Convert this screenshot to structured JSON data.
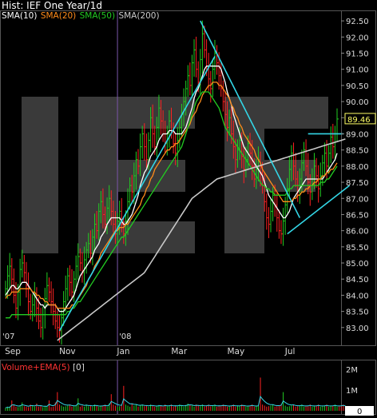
{
  "header": {
    "title": "Hist: IEF One Year/1d"
  },
  "legend": [
    {
      "label": "SMA(10)",
      "color": "#ffffff"
    },
    {
      "label": "SMA(20)",
      "color": "#ff8c1a"
    },
    {
      "label": "SMA(50)",
      "color": "#22cc22"
    },
    {
      "label": "SMA(200)",
      "color": "#cccccc"
    }
  ],
  "volume_legend": {
    "label": "Volume+EMA(5)",
    "label_color": "#ff3333",
    "bracket": "[0]"
  },
  "colors": {
    "background": "#000000",
    "up_bar": "#22cc22",
    "down_bar": "#ff2222",
    "trendline": "#33d6e6",
    "watermark": "#3a3a3a",
    "last_price_box": "#ffff66"
  },
  "watermark_text": "IEF",
  "chart_data": [
    {
      "type": "line",
      "title": "Hist: IEF One Year/1d",
      "ylim": [
        82.5,
        92.8
      ],
      "yticks": [
        83.0,
        83.5,
        84.0,
        84.5,
        85.0,
        85.5,
        86.0,
        86.5,
        87.0,
        87.5,
        88.0,
        88.5,
        89.0,
        89.5,
        90.0,
        90.5,
        91.0,
        91.5,
        92.0,
        92.5
      ],
      "ytick_labels": [
        "83.00",
        "83.50",
        "84.00",
        "84.50",
        "85.00",
        "85.50",
        "86.00",
        "86.50",
        "87.00",
        "87.50",
        "88.00",
        "88.50",
        "89.00",
        "89.50",
        "90.00",
        "90.50",
        "91.00",
        "91.50",
        "92.00",
        "92.50"
      ],
      "x_labels": [
        "Sep",
        "Nov",
        "Jan",
        "Mar",
        "May",
        "Jul"
      ],
      "year_markers": [
        "'07",
        "'08"
      ],
      "last_price": 89.46,
      "last_price_label": "89.46",
      "grid": false,
      "legend_placement": "top-left",
      "closes": [
        84.2,
        84.6,
        84.9,
        84.5,
        84.0,
        83.6,
        84.1,
        84.8,
        85.0,
        84.7,
        84.3,
        83.8,
        83.5,
        83.7,
        84.0,
        83.6,
        83.2,
        83.0,
        83.4,
        83.9,
        84.3,
        84.1,
        83.8,
        83.5,
        83.2,
        83.0,
        82.9,
        83.3,
        83.8,
        84.2,
        84.6,
        84.4,
        84.1,
        84.5,
        84.9,
        85.2,
        85.0,
        84.7,
        85.1,
        85.4,
        85.6,
        85.3,
        85.8,
        86.2,
        86.0,
        86.6,
        86.9,
        86.5,
        86.2,
        86.7,
        87.0,
        86.6,
        86.2,
        85.9,
        86.3,
        86.6,
        86.2,
        85.9,
        86.3,
        86.9,
        87.4,
        87.2,
        87.7,
        88.2,
        88.0,
        88.6,
        89.0,
        88.6,
        88.2,
        88.8,
        89.5,
        89.0,
        88.6,
        89.2,
        89.8,
        89.4,
        89.0,
        88.7,
        89.0,
        89.4,
        89.1,
        88.7,
        88.4,
        88.8,
        89.2,
        89.6,
        90.0,
        90.4,
        90.8,
        90.5,
        91.2,
        91.6,
        91.0,
        90.6,
        91.3,
        92.1,
        91.6,
        91.1,
        90.7,
        90.4,
        91.0,
        91.5,
        91.2,
        90.8,
        90.4,
        90.0,
        89.6,
        89.2,
        89.5,
        89.0,
        88.6,
        88.2,
        88.5,
        88.8,
        88.3,
        87.9,
        88.2,
        88.7,
        88.4,
        88.0,
        87.6,
        87.9,
        88.2,
        87.8,
        87.4,
        86.9,
        86.4,
        86.2,
        86.6,
        87.1,
        86.8,
        86.4,
        86.0,
        85.9,
        86.3,
        86.8,
        87.3,
        87.9,
        88.4,
        88.0,
        87.6,
        87.2,
        87.6,
        88.1,
        88.5,
        88.0,
        87.5,
        87.2,
        87.6,
        88.0,
        87.7,
        87.3,
        87.7,
        88.1,
        88.4,
        88.0,
        88.4,
        88.9,
        88.6,
        89.0,
        89.46
      ],
      "series": [
        {
          "name": "SMA(10)",
          "values": [
            84.0,
            84.1,
            84.2,
            84.3,
            84.3,
            84.2,
            84.2,
            84.3,
            84.4,
            84.4,
            84.4,
            84.3,
            84.2,
            84.1,
            84.0,
            83.9,
            83.8,
            83.7,
            83.7,
            83.6,
            83.7,
            83.7,
            83.7,
            83.7,
            83.7,
            83.6,
            83.5,
            83.5,
            83.5,
            83.6,
            83.7,
            83.8,
            83.9,
            84.0,
            84.2,
            84.4,
            84.6,
            84.7,
            84.8,
            84.9,
            85.0,
            85.1,
            85.2,
            85.4,
            85.5,
            85.6,
            85.8,
            85.9,
            86.0,
            86.2,
            86.3,
            86.4,
            86.4,
            86.4,
            86.4,
            86.4,
            86.3,
            86.2,
            86.2,
            86.3,
            86.4,
            86.5,
            86.7,
            86.9,
            87.1,
            87.4,
            87.6,
            87.8,
            87.9,
            88.1,
            88.3,
            88.4,
            88.5,
            88.6,
            88.8,
            88.9,
            89.0,
            89.0,
            89.0,
            89.1,
            89.1,
            89.1,
            89.0,
            89.0,
            89.0,
            89.0,
            89.1,
            89.2,
            89.4,
            89.6,
            89.8,
            90.1,
            90.3,
            90.4,
            90.6,
            90.8,
            91.0,
            91.1,
            91.1,
            91.1,
            91.1,
            91.1,
            91.1,
            91.1,
            91.0,
            90.8,
            90.6,
            90.3,
            90.1,
            89.9,
            89.6,
            89.4,
            89.2,
            89.0,
            88.8,
            88.6,
            88.5,
            88.4,
            88.3,
            88.2,
            88.1,
            88.0,
            87.9,
            87.8,
            87.7,
            87.5,
            87.3,
            87.1,
            87.0,
            86.9,
            86.8,
            86.7,
            86.6,
            86.5,
            86.4,
            86.4,
            86.5,
            86.6,
            86.8,
            87.0,
            87.1,
            87.2,
            87.3,
            87.4,
            87.5,
            87.6,
            87.6,
            87.6,
            87.6,
            87.6,
            87.6,
            87.6,
            87.6,
            87.6,
            87.7,
            87.8,
            87.9,
            88.0,
            88.1,
            88.2,
            88.4
          ]
        },
        {
          "name": "SMA(20)",
          "values": [
            83.9,
            84.0,
            84.0,
            84.1,
            84.1,
            84.1,
            84.1,
            84.2,
            84.2,
            84.2,
            84.2,
            84.2,
            84.2,
            84.1,
            84.1,
            84.0,
            84.0,
            83.9,
            83.9,
            83.8,
            83.8,
            83.7,
            83.7,
            83.7,
            83.7,
            83.6,
            83.6,
            83.6,
            83.6,
            83.6,
            83.6,
            83.6,
            83.7,
            83.7,
            83.8,
            83.9,
            84.0,
            84.1,
            84.2,
            84.3,
            84.5,
            84.6,
            84.7,
            84.9,
            85.0,
            85.1,
            85.3,
            85.4,
            85.5,
            85.6,
            85.7,
            85.8,
            85.9,
            86.0,
            86.0,
            86.1,
            86.1,
            86.1,
            86.2,
            86.2,
            86.3,
            86.4,
            86.5,
            86.6,
            86.7,
            86.8,
            87.0,
            87.1,
            87.3,
            87.4,
            87.6,
            87.7,
            87.9,
            88.0,
            88.1,
            88.2,
            88.3,
            88.4,
            88.5,
            88.5,
            88.6,
            88.6,
            88.7,
            88.7,
            88.8,
            88.9,
            89.0,
            89.1,
            89.2,
            89.3,
            89.5,
            89.6,
            89.7,
            89.9,
            90.0,
            90.2,
            90.3,
            90.4,
            90.5,
            90.5,
            90.6,
            90.6,
            90.6,
            90.5,
            90.5,
            90.4,
            90.3,
            90.2,
            90.1,
            89.9,
            89.8,
            89.6,
            89.5,
            89.3,
            89.2,
            89.0,
            88.9,
            88.8,
            88.7,
            88.6,
            88.5,
            88.3,
            88.2,
            88.1,
            87.9,
            87.8,
            87.7,
            87.6,
            87.5,
            87.4,
            87.3,
            87.2,
            87.1,
            87.0,
            86.9,
            86.9,
            86.9,
            86.9,
            86.9,
            87.0,
            87.0,
            87.1,
            87.1,
            87.2,
            87.2,
            87.3,
            87.3,
            87.4,
            87.4,
            87.5,
            87.5,
            87.6,
            87.6,
            87.7,
            87.7,
            87.8,
            87.8,
            87.9,
            87.9,
            88.0,
            88.1
          ]
        },
        {
          "name": "SMA(50)",
          "values": [
            83.3,
            83.3,
            83.3,
            83.4,
            83.4,
            83.4,
            83.4,
            83.4,
            83.4,
            83.4,
            83.4,
            83.4,
            83.4,
            83.4,
            83.4,
            83.4,
            83.4,
            83.4,
            83.4,
            83.4,
            83.4,
            83.4,
            83.4,
            83.4,
            83.4,
            83.4,
            83.4,
            83.4,
            83.4,
            83.4,
            83.5,
            83.5,
            83.6,
            83.6,
            83.7,
            83.8,
            83.8,
            83.9,
            84.0,
            84.1,
            84.2,
            84.3,
            84.4,
            84.5,
            84.6,
            84.7,
            84.8,
            84.9,
            85.0,
            85.1,
            85.2,
            85.3,
            85.4,
            85.5,
            85.6,
            85.7,
            85.8,
            85.8,
            85.9,
            86.0,
            86.1,
            86.2,
            86.3,
            86.4,
            86.5,
            86.6,
            86.7,
            86.8,
            86.9,
            87.0,
            87.1,
            87.2,
            87.3,
            87.4,
            87.5,
            87.6,
            87.7,
            87.8,
            87.9,
            88.0,
            88.1,
            88.2,
            88.3,
            88.4,
            88.5,
            88.6,
            88.8,
            89.0,
            89.2,
            89.4,
            89.6,
            89.8,
            90.0,
            90.1,
            90.2,
            90.3,
            90.3,
            90.3,
            90.3,
            90.2,
            90.1,
            90.0,
            89.9,
            89.8,
            89.6,
            89.4,
            89.2,
            89.1,
            89.0,
            88.9,
            88.8,
            88.7,
            88.6,
            88.5,
            88.4,
            88.3,
            88.2,
            88.1,
            88.0,
            87.9,
            87.8,
            87.7,
            87.6,
            87.5,
            87.4,
            87.4,
            87.3,
            87.3,
            87.2,
            87.2,
            87.1,
            87.1,
            87.1,
            87.1,
            87.1,
            87.1,
            87.2,
            87.3,
            87.3,
            87.4,
            87.4,
            87.4,
            87.4,
            87.4,
            87.4,
            87.4,
            87.4,
            87.4,
            87.4,
            87.4,
            87.4,
            87.4,
            87.5,
            87.5,
            87.5,
            87.6,
            87.6,
            87.7,
            87.8,
            87.9,
            88.0
          ]
        },
        {
          "name": "SMA(200)",
          "values": [
            null,
            null,
            null,
            null,
            null,
            null,
            null,
            null,
            null,
            null,
            null,
            null,
            null,
            null,
            null,
            null,
            null,
            null,
            null,
            null,
            null,
            null,
            null,
            null,
            null,
            82.6,
            82.65,
            82.7,
            82.75,
            82.8,
            82.85,
            82.9,
            82.95,
            83.0,
            83.05,
            83.1,
            83.15,
            83.2,
            83.25,
            83.3,
            83.35,
            83.4,
            83.45,
            83.5,
            83.55,
            83.6,
            83.65,
            83.7,
            83.75,
            83.8,
            83.85,
            83.9,
            83.95,
            84.0,
            84.05,
            84.1,
            84.15,
            84.2,
            84.25,
            84.3,
            84.35,
            84.4,
            84.45,
            84.5,
            84.55,
            84.6,
            84.65,
            84.7,
            84.8,
            84.9,
            85.0,
            85.1,
            85.2,
            85.3,
            85.4,
            85.5,
            85.6,
            85.7,
            85.8,
            85.9,
            86.0,
            86.1,
            86.2,
            86.3,
            86.4,
            86.5,
            86.6,
            86.7,
            86.8,
            86.9,
            87.0,
            87.05,
            87.1,
            87.15,
            87.2,
            87.25,
            87.3,
            87.35,
            87.4,
            87.45,
            87.5,
            87.55,
            87.6,
            87.62,
            87.64,
            87.66,
            87.68,
            87.7,
            87.72,
            87.74,
            87.76,
            87.78,
            87.8,
            87.82,
            87.84,
            87.86,
            87.88,
            87.9,
            87.92,
            87.94,
            87.96,
            87.98,
            88.0,
            88.02,
            88.04,
            88.06,
            88.08,
            88.1,
            88.12,
            88.14,
            88.16,
            88.18,
            88.2,
            88.22,
            88.24,
            88.26,
            88.28,
            88.3,
            88.32,
            88.34,
            88.36,
            88.38,
            88.4,
            88.42,
            88.44,
            88.46,
            88.48,
            88.5,
            88.52,
            88.54,
            88.56,
            88.58,
            88.6,
            88.62,
            88.64,
            88.66,
            88.68,
            88.7,
            88.72,
            88.74,
            88.76,
            88.78,
            88.8,
            88.82,
            88.84
          ]
        }
      ],
      "trendlines": [
        {
          "from": [
            26,
            82.9
          ],
          "to": [
            101,
            91.4
          ]
        },
        {
          "from": [
            94,
            92.5
          ],
          "to": [
            142,
            86.4
          ]
        },
        {
          "from": [
            136,
            85.9
          ],
          "to": [
            166,
            87.4
          ]
        },
        {
          "from": [
            146,
            89.0
          ],
          "to": [
            163,
            89.0
          ]
        }
      ]
    },
    {
      "type": "bar",
      "title": "Volume+EMA(5) [0]",
      "ylim": [
        0,
        2000000
      ],
      "ytick_labels": [
        "2M",
        "1M",
        "0"
      ],
      "last_value_label": "0",
      "volume": [
        0.15,
        0.2,
        0.18,
        0.5,
        0.3,
        0.2,
        0.18,
        0.25,
        0.4,
        0.22,
        0.2,
        0.18,
        0.3,
        0.25,
        0.2,
        0.35,
        0.2,
        0.25,
        0.18,
        0.22,
        0.2,
        0.5,
        0.18,
        0.2,
        0.4,
        0.9,
        0.3,
        0.25,
        0.2,
        0.22,
        0.25,
        0.3,
        0.2,
        0.22,
        0.25,
        0.6,
        0.2,
        0.25,
        0.2,
        0.3,
        0.22,
        0.25,
        0.2,
        0.3,
        0.25,
        0.2,
        0.22,
        0.25,
        0.3,
        0.2,
        0.35,
        0.8,
        0.3,
        0.25,
        0.2,
        0.22,
        0.25,
        1.2,
        0.3,
        0.25,
        0.2,
        0.35,
        0.25,
        0.3,
        0.2,
        0.25,
        0.3,
        0.22,
        0.25,
        0.2,
        0.3,
        0.25,
        0.2,
        0.22,
        0.28,
        0.25,
        0.2,
        0.3,
        0.22,
        0.25,
        0.3,
        0.2,
        0.25,
        0.22,
        0.3,
        0.25,
        0.2,
        0.28,
        0.35,
        0.3,
        0.25,
        0.2,
        0.3,
        0.25,
        0.22,
        0.3,
        0.2,
        0.25,
        0.3,
        0.22,
        0.25,
        0.3,
        0.2,
        0.25,
        0.22,
        0.3,
        0.25,
        0.2,
        0.22,
        0.25,
        0.3,
        0.2,
        0.25,
        0.22,
        0.3,
        0.25,
        0.2,
        0.22,
        0.25,
        0.3,
        0.2,
        0.22,
        0.25,
        1.6,
        0.3,
        0.25,
        0.2,
        0.22,
        0.25,
        0.3,
        0.2,
        0.22,
        0.25,
        0.3,
        0.9,
        0.25,
        0.2,
        0.22,
        0.25,
        0.3,
        0.2,
        0.22,
        0.25,
        0.3,
        0.2,
        0.22,
        0.25,
        0.3,
        0.2,
        0.22,
        0.25,
        0.3,
        0.2,
        0.22,
        0.25,
        0.3,
        0.2,
        0.22,
        0.25,
        0.3,
        0.2,
        0.22,
        0.25,
        0.3,
        0.2
      ]
    }
  ]
}
